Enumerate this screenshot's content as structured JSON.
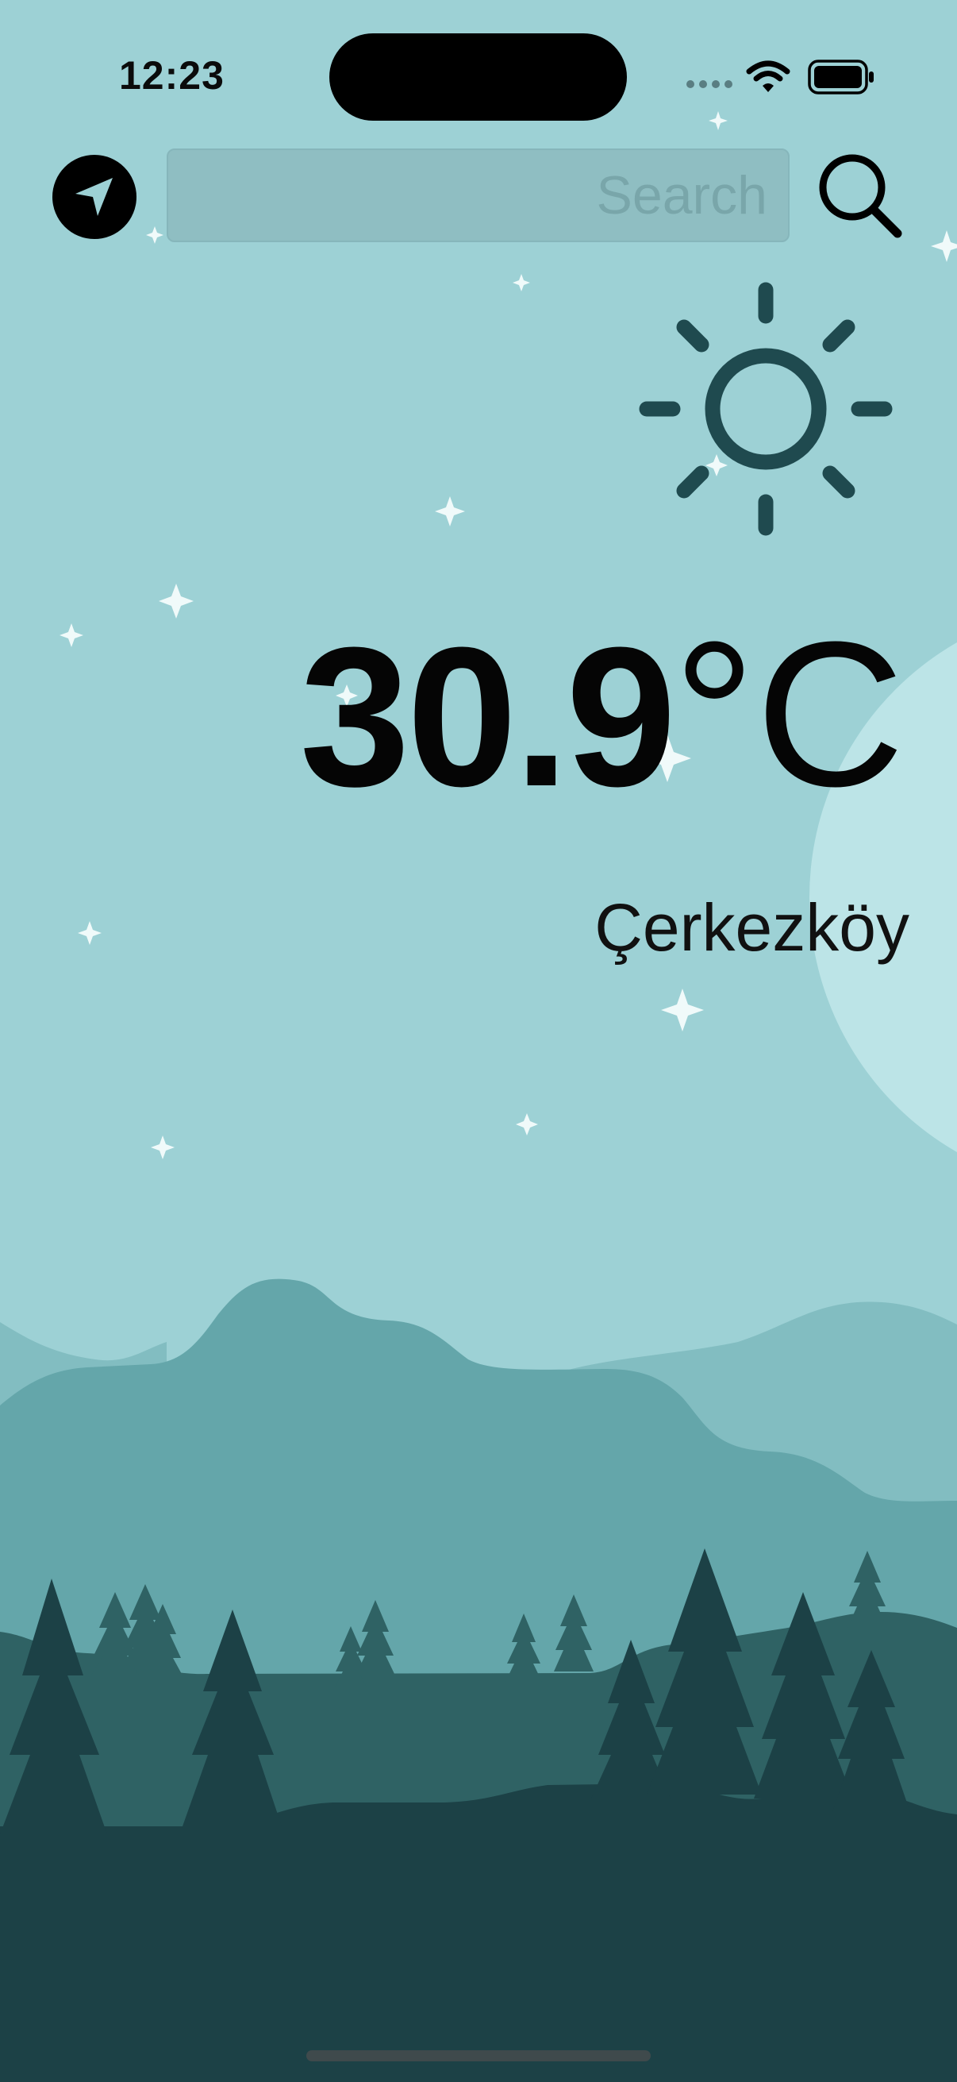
{
  "status_bar": {
    "time": "12:23",
    "icons": [
      "signal-dots-icon",
      "wifi-icon",
      "battery-icon"
    ]
  },
  "toolbar": {
    "location_icon": "location-arrow-icon",
    "search_placeholder": "Search",
    "search_value": "",
    "search_icon": "magnifier-icon"
  },
  "weather": {
    "condition_icon": "sun-icon",
    "temperature": "30.9",
    "unit": "°C",
    "city": "Çerkezköy"
  },
  "colors": {
    "sky": "#9dd1d5",
    "moon": "#bce4e7",
    "hill_far_light": "#82bdc1",
    "hill_mid": "#64a6aa",
    "hill_near": "#2f6264",
    "foreground": "#1c4146",
    "sun_stroke": "#1f4a4f",
    "star": "#f0fafa"
  }
}
